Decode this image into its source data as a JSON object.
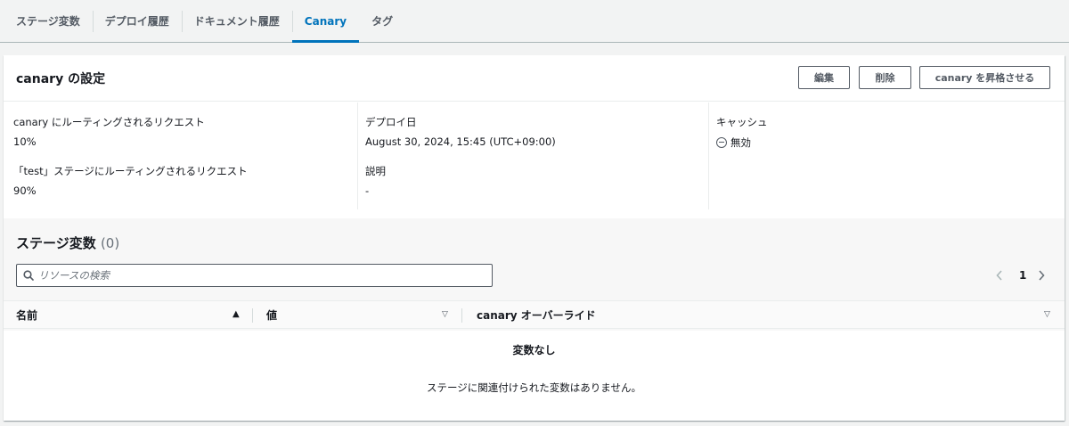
{
  "tabs": [
    {
      "label": "ステージ変数"
    },
    {
      "label": "デプロイ履歴"
    },
    {
      "label": "ドキュメント履歴"
    },
    {
      "label": "Canary"
    },
    {
      "label": "タグ"
    }
  ],
  "active_tab": "Canary",
  "card": {
    "title": "canary の設定",
    "buttons": {
      "edit": "編集",
      "delete": "削除",
      "promote": "canary を昇格させる"
    }
  },
  "details": {
    "canary_requests_label": "canary にルーティングされるリクエスト",
    "canary_requests_value": "10%",
    "stage_requests_label": "「test」ステージにルーティングされるリクエスト",
    "stage_requests_value": "90%",
    "deploy_date_label": "デプロイ日",
    "deploy_date_value": "August 30, 2024, 15:45 (UTC+09:00)",
    "description_label": "説明",
    "description_value": "-",
    "cache_label": "キャッシュ",
    "cache_value": "無効",
    "cache_icon": "disabled-circle-icon"
  },
  "stage_variables": {
    "title": "ステージ変数",
    "count": "(0)",
    "search_placeholder": "リソースの検索",
    "page": "1",
    "columns": [
      "名前",
      "値",
      "canary オーバーライド"
    ],
    "empty_title": "変数なし",
    "empty_desc": "ステージに関連付けられた変数はありません。"
  },
  "colors": {
    "accent": "#0073bb",
    "text": "#16191f",
    "background": "#f2f3f3"
  }
}
